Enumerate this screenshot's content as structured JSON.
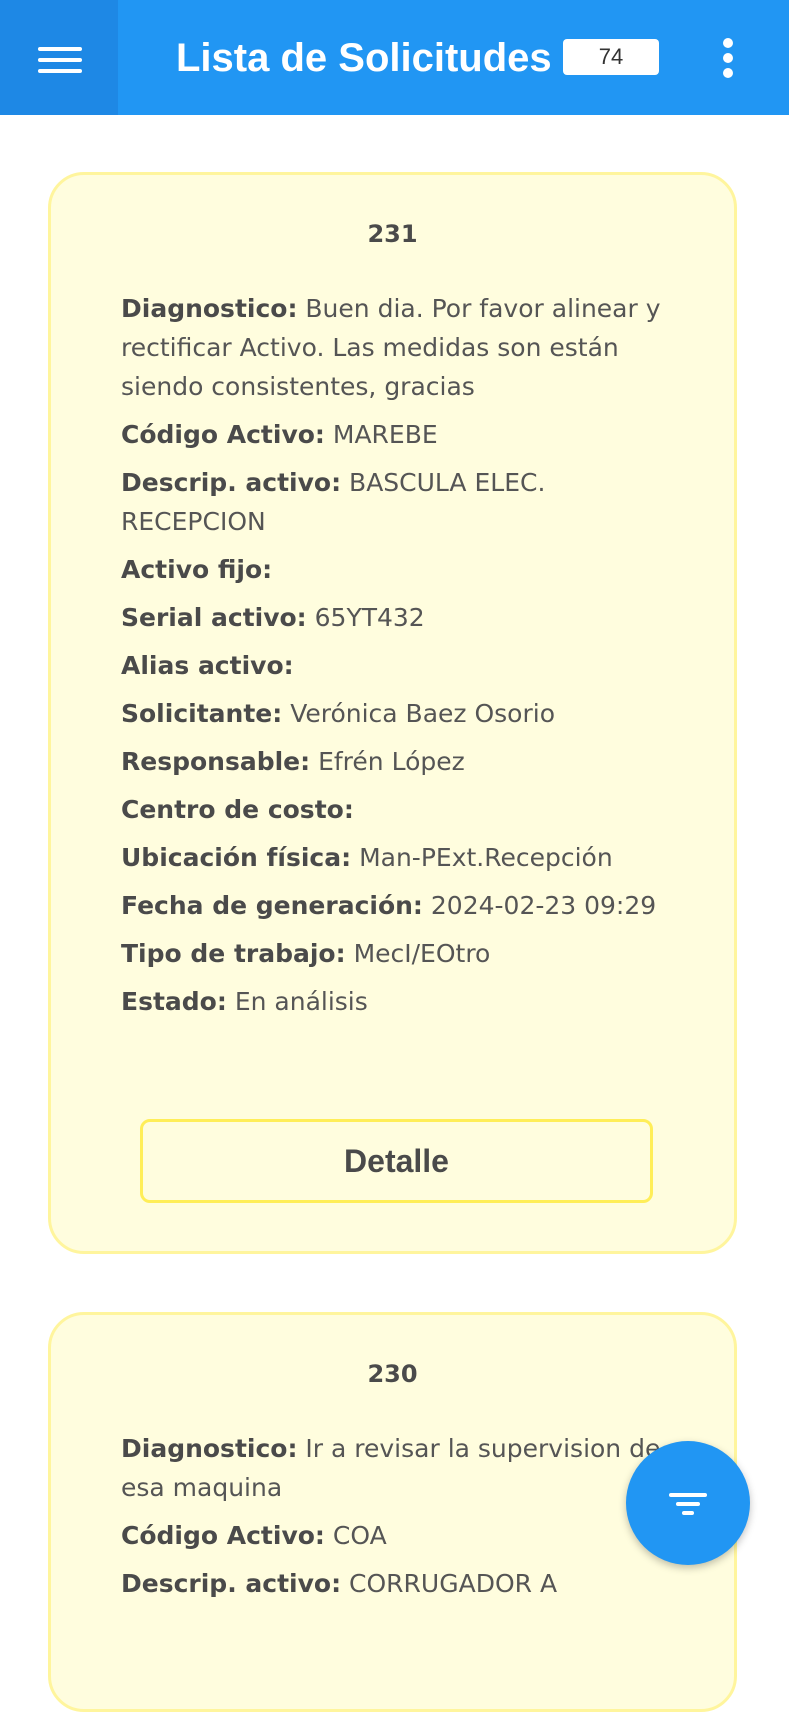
{
  "appbar": {
    "title": "Lista de Solicitudes",
    "count": "74",
    "menu_icon": "hamburger-menu-icon",
    "more_icon": "more-vertical-icon",
    "color": "#2196F3"
  },
  "cards": [
    {
      "id": "231",
      "fields": [
        {
          "label": "Diagnostico:",
          "value": "Buen dia. Por favor alinear y rectificar Activo. Las medidas son están siendo consistentes, gracias"
        },
        {
          "label": "Código Activo:",
          "value": "MAREBE"
        },
        {
          "label": "Descrip. activo:",
          "value": "BASCULA ELEC. RECEPCION"
        },
        {
          "label": "Activo fijo:",
          "value": ""
        },
        {
          "label": "Serial activo:",
          "value": "65YT432"
        },
        {
          "label": "Alias activo:",
          "value": ""
        },
        {
          "label": "Solicitante:",
          "value": "Verónica Baez Osorio"
        },
        {
          "label": "Responsable:",
          "value": "Efrén López"
        },
        {
          "label": "Centro de costo:",
          "value": ""
        },
        {
          "label": "Ubicación física:",
          "value": "Man-PExt.Recepción"
        },
        {
          "label": "Fecha de generación:",
          "value": "2024-02-23 09:29"
        },
        {
          "label": "Tipo de trabajo:",
          "value": "MecI/EOtro"
        },
        {
          "label": "Estado:",
          "value": "En análisis"
        }
      ],
      "button_label": "Detalle"
    },
    {
      "id": "230",
      "fields": [
        {
          "label": "Diagnostico:",
          "value": "Ir a revisar la supervision de esa maquina"
        },
        {
          "label": "Código Activo:",
          "value": "COA"
        },
        {
          "label": "Descrip. activo:",
          "value": "CORRUGADOR A"
        }
      ]
    }
  ],
  "fab": {
    "icon": "filter-icon",
    "color": "#2196F3"
  }
}
